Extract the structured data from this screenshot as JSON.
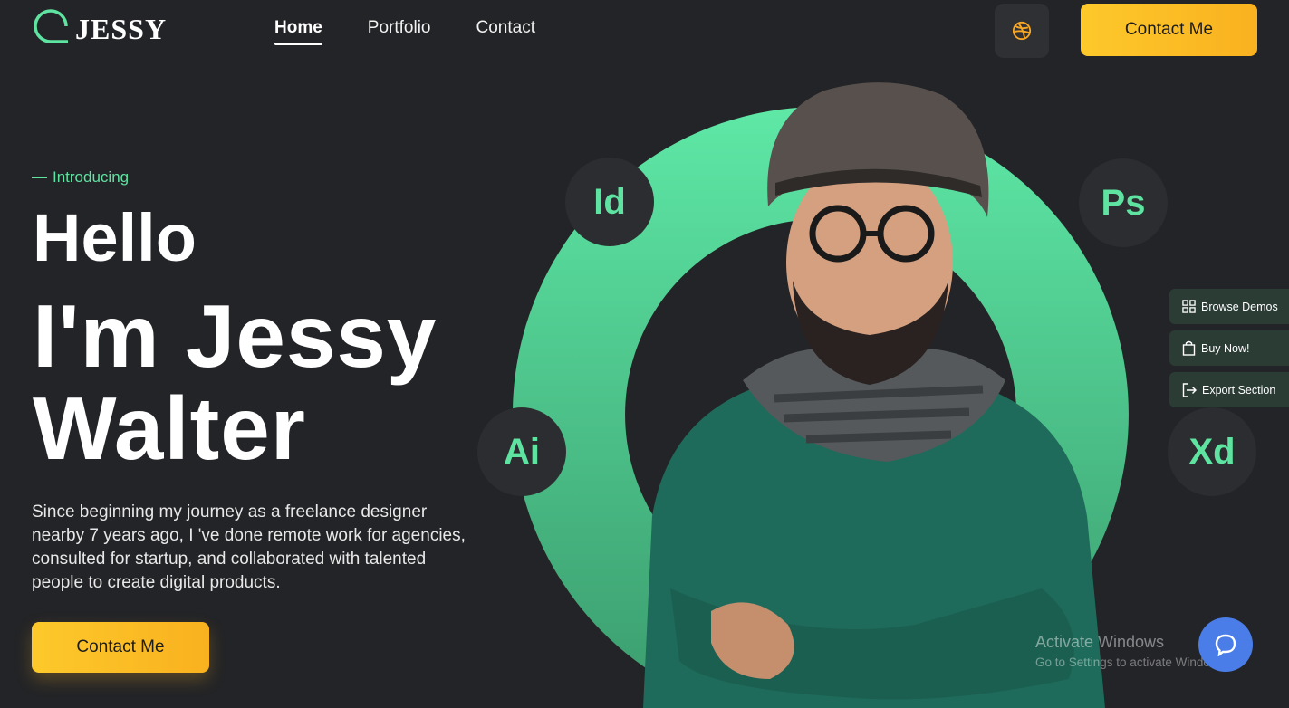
{
  "brand": {
    "name": "JESSY",
    "icon": "logo-mark-icon",
    "accent": "#5ee3a1"
  },
  "nav": {
    "items": [
      {
        "label": "Home",
        "active": true
      },
      {
        "label": "Portfolio",
        "active": false
      },
      {
        "label": "Contact",
        "active": false
      }
    ]
  },
  "header": {
    "dribbble_icon": "dribbble-icon",
    "cta_label": "Contact Me"
  },
  "hero": {
    "intro": "Introducing",
    "line1": "Hello",
    "line2": "I'm Jessy",
    "line3": "Walter",
    "description": "Since beginning my journey as a freelance designer nearby 7 years ago, I 've done remote work for agencies, consulted for startup, and collaborated with talented people to create digital products.",
    "cta_label": "Contact Me"
  },
  "tools": [
    {
      "label": "Id"
    },
    {
      "label": "Ps"
    },
    {
      "label": "Ai"
    },
    {
      "label": "Xd"
    }
  ],
  "side_panel": [
    {
      "label": "Browse Demos",
      "icon": "grid-icon"
    },
    {
      "label": "Buy Now!",
      "icon": "shopping-bag-icon"
    },
    {
      "label": "Export Section",
      "icon": "export-icon"
    }
  ],
  "watermark": {
    "title": "Activate Windows",
    "subtitle": "Go to Settings to activate Windows."
  },
  "chat": {
    "icon": "chat-bubble-icon"
  },
  "colors": {
    "background": "#232427",
    "accent": "#5ee3a1",
    "button": "#fdc92b",
    "chat": "#4a7de8"
  }
}
